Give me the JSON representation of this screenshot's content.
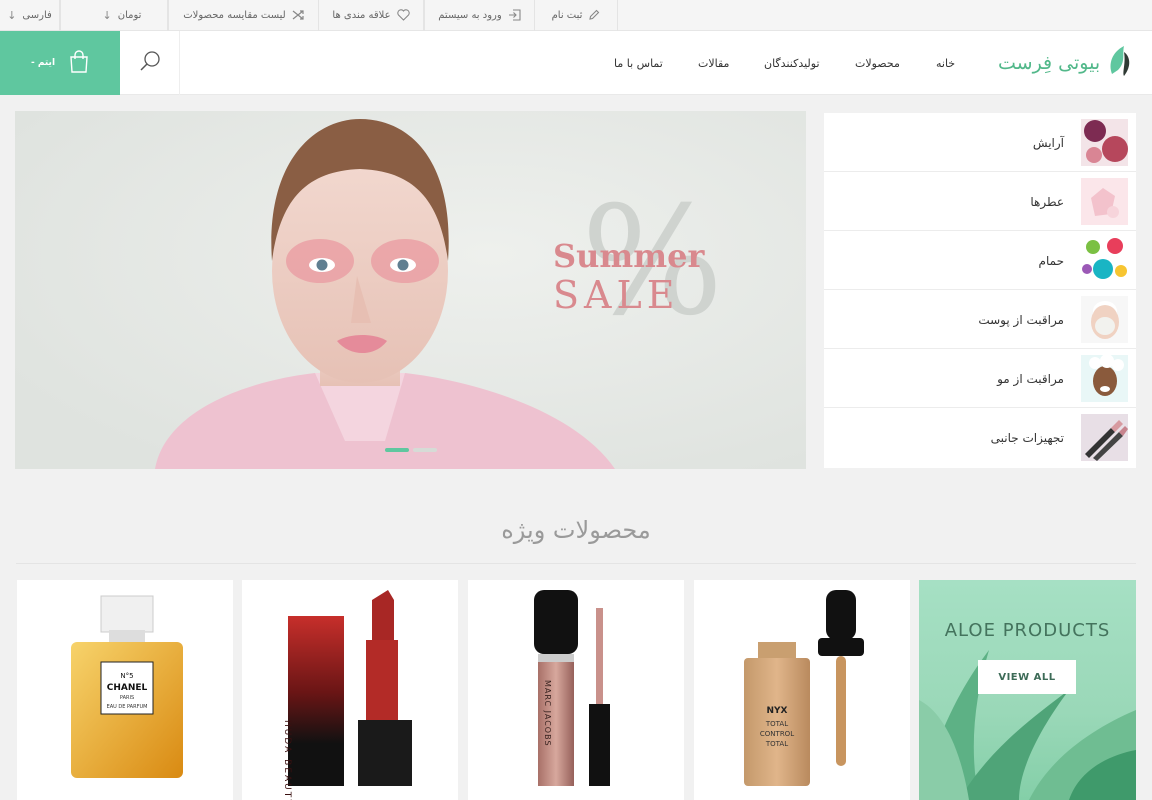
{
  "topbar": {
    "language": "فارسی",
    "currency": "تومان",
    "compare": "لیست مقایسه محصولات",
    "wishlist": "علاقه مندی ها",
    "login": "ورود به سیستم",
    "register": "ثبت نام"
  },
  "header": {
    "logo_text": "بیوتی فِرست",
    "cart_label": "- ایتم",
    "nav": [
      "خانه",
      "محصولات",
      "تولیدکنندگان",
      "مقالات",
      "تماس با ما"
    ]
  },
  "banner": {
    "line1": "Summer",
    "line2": "SALE",
    "symbol": "%",
    "slide_count": 2,
    "active_slide": 1
  },
  "categories": [
    {
      "label": "آرایش"
    },
    {
      "label": "عطرها"
    },
    {
      "label": "حمام"
    },
    {
      "label": "مراقبت از پوست"
    },
    {
      "label": "مراقبت از مو"
    },
    {
      "label": "تجهیزات جانبی"
    }
  ],
  "section": {
    "title": "محصولات ویژه"
  },
  "products": {
    "perfume": {
      "brand": "CHANEL",
      "number": "N°5",
      "city": "PARIS",
      "type": "EAU DE PARFUM"
    },
    "lipstick": {
      "brand": "HUDA BEAUTY"
    },
    "gloss": {
      "brand": "MARC JACOBS"
    },
    "foundation": {
      "brand": "NYX",
      "line1": "TOTAL",
      "line2": "CONTROL",
      "line3": "TOTAL"
    }
  },
  "promo": {
    "title": "ALOE PRODUCTS",
    "button": "VIEW ALL"
  },
  "colors": {
    "accent": "#5fc79f",
    "sale_text": "#d9898e",
    "background": "#f1f1f1"
  }
}
